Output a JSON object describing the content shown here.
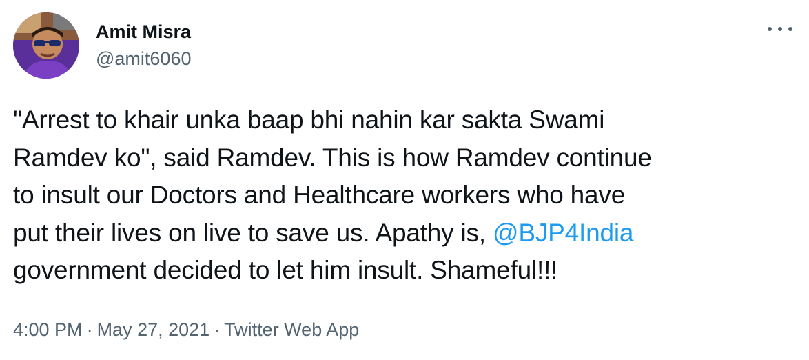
{
  "author": {
    "display_name": "Amit Misra",
    "handle": "@amit6060"
  },
  "tweet": {
    "lines": [
      "\"Arrest to khair unka baap bhi nahin kar sakta Swami",
      "Ramdev ko\", said Ramdev. This is how Ramdev continue",
      "to insult our Doctors and Healthcare workers who have",
      "put their lives on live to save us. Apathy is, "
    ],
    "mention": "@BJP4India",
    "last_line": "government decided to let him insult. Shameful!!!"
  },
  "meta": {
    "time": "4:00 PM",
    "date": "May 27, 2021",
    "source": "Twitter Web App",
    "separator": "·"
  },
  "icons": {
    "more": "more-dots-icon",
    "avatar": "profile-photo"
  },
  "colors": {
    "text": "#0f1419",
    "secondary": "#536471",
    "link": "#1d9bf0"
  }
}
